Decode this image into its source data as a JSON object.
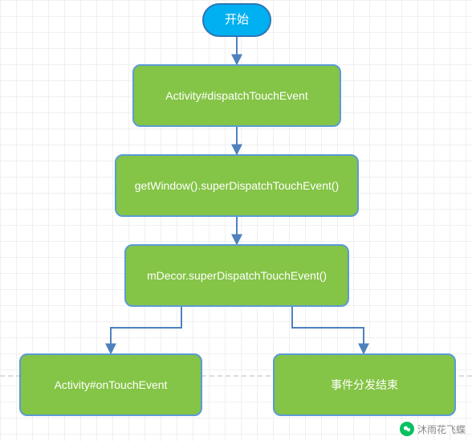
{
  "chart_data": {
    "type": "flowchart",
    "title": "",
    "nodes": [
      {
        "id": "start",
        "shape": "terminator",
        "label": "开始"
      },
      {
        "id": "n1",
        "shape": "process",
        "label": "Activity#dispatchTouchEvent"
      },
      {
        "id": "n2",
        "shape": "process",
        "label": "getWindow().superDispatchTouchEvent()"
      },
      {
        "id": "n3",
        "shape": "process",
        "label": "mDecor.superDispatchTouchEvent()"
      },
      {
        "id": "n4",
        "shape": "process",
        "label": "Activity#onTouchEvent"
      },
      {
        "id": "n5",
        "shape": "process",
        "label": "事件分发结束"
      }
    ],
    "edges": [
      {
        "from": "start",
        "to": "n1"
      },
      {
        "from": "n1",
        "to": "n2"
      },
      {
        "from": "n2",
        "to": "n3"
      },
      {
        "from": "n3",
        "to": "n4"
      },
      {
        "from": "n3",
        "to": "n5"
      }
    ]
  },
  "colors": {
    "start_fill": "#00b0f0",
    "process_fill": "#84c446",
    "border": "#5b9bd5",
    "arrow": "#4f81bd"
  },
  "watermark": "沐雨花飞蝶"
}
